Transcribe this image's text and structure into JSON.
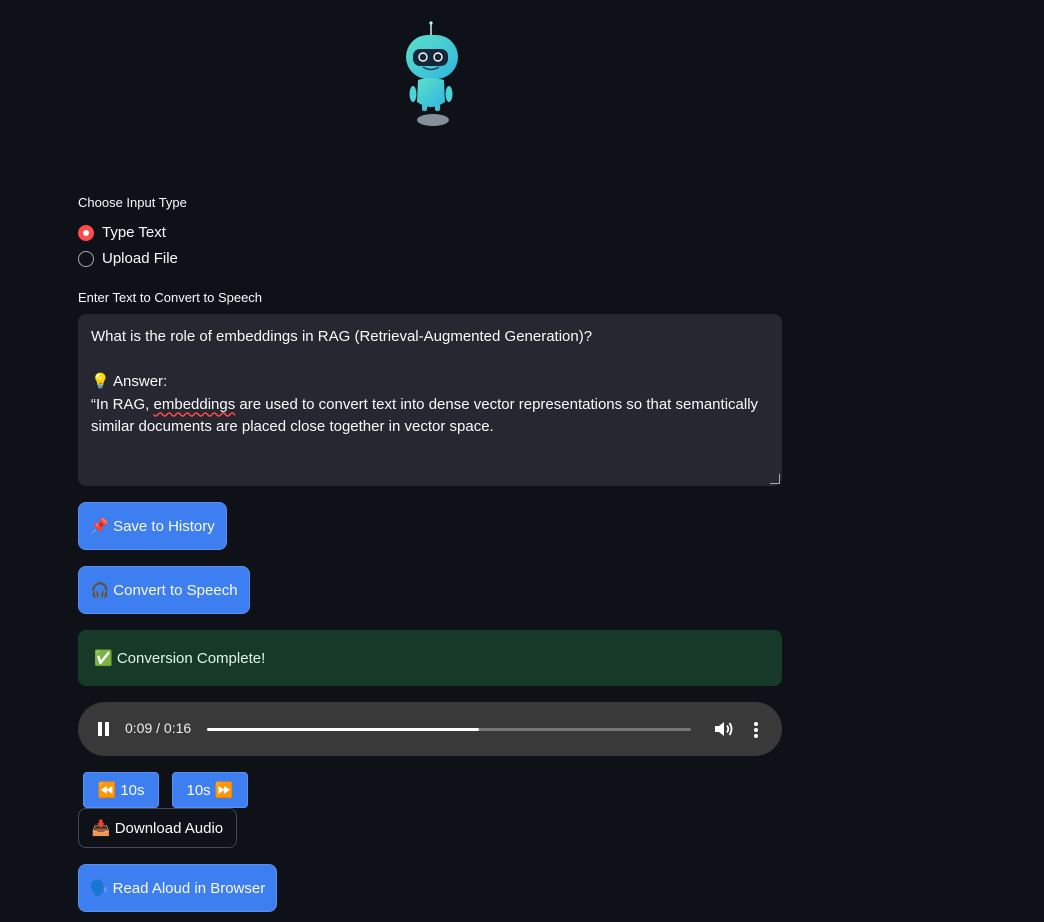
{
  "input_type": {
    "label": "Choose Input Type",
    "options": [
      "Type Text",
      "Upload File"
    ],
    "selected": "Type Text"
  },
  "text_input": {
    "label": "Enter Text to Convert to Speech",
    "lines": [
      "What is the role of embeddings in RAG (Retrieval-Augmented Generation)?",
      "",
      "💡 Answer:",
      "“In RAG, embeddings are used to convert text into dense vector representations so that semantically",
      "similar documents are placed close together in vector space."
    ],
    "line4_before": "“In RAG, ",
    "line4_misspelled": "embeddings",
    "line4_after": " are used to convert text into dense vector representations so that semantically"
  },
  "buttons": {
    "save": "📌 Save to History",
    "convert": "🎧 Convert to Speech",
    "rewind": "⏪ 10s",
    "forward": "10s ⏩",
    "download": "📥 Download Audio",
    "read_aloud": "🗣️ Read Aloud in Browser"
  },
  "status": {
    "message": "✅ Conversion Complete!"
  },
  "audio_player": {
    "time_display": "0:09 / 0:16",
    "progress": 0.5625,
    "icons": [
      "pause-icon",
      "volume-icon",
      "more-options-icon"
    ]
  },
  "colors": {
    "background": "#0e1117",
    "primary": "#3d7ef0",
    "radio_selected": "#ff4b4b",
    "success_bg": "#173928"
  }
}
